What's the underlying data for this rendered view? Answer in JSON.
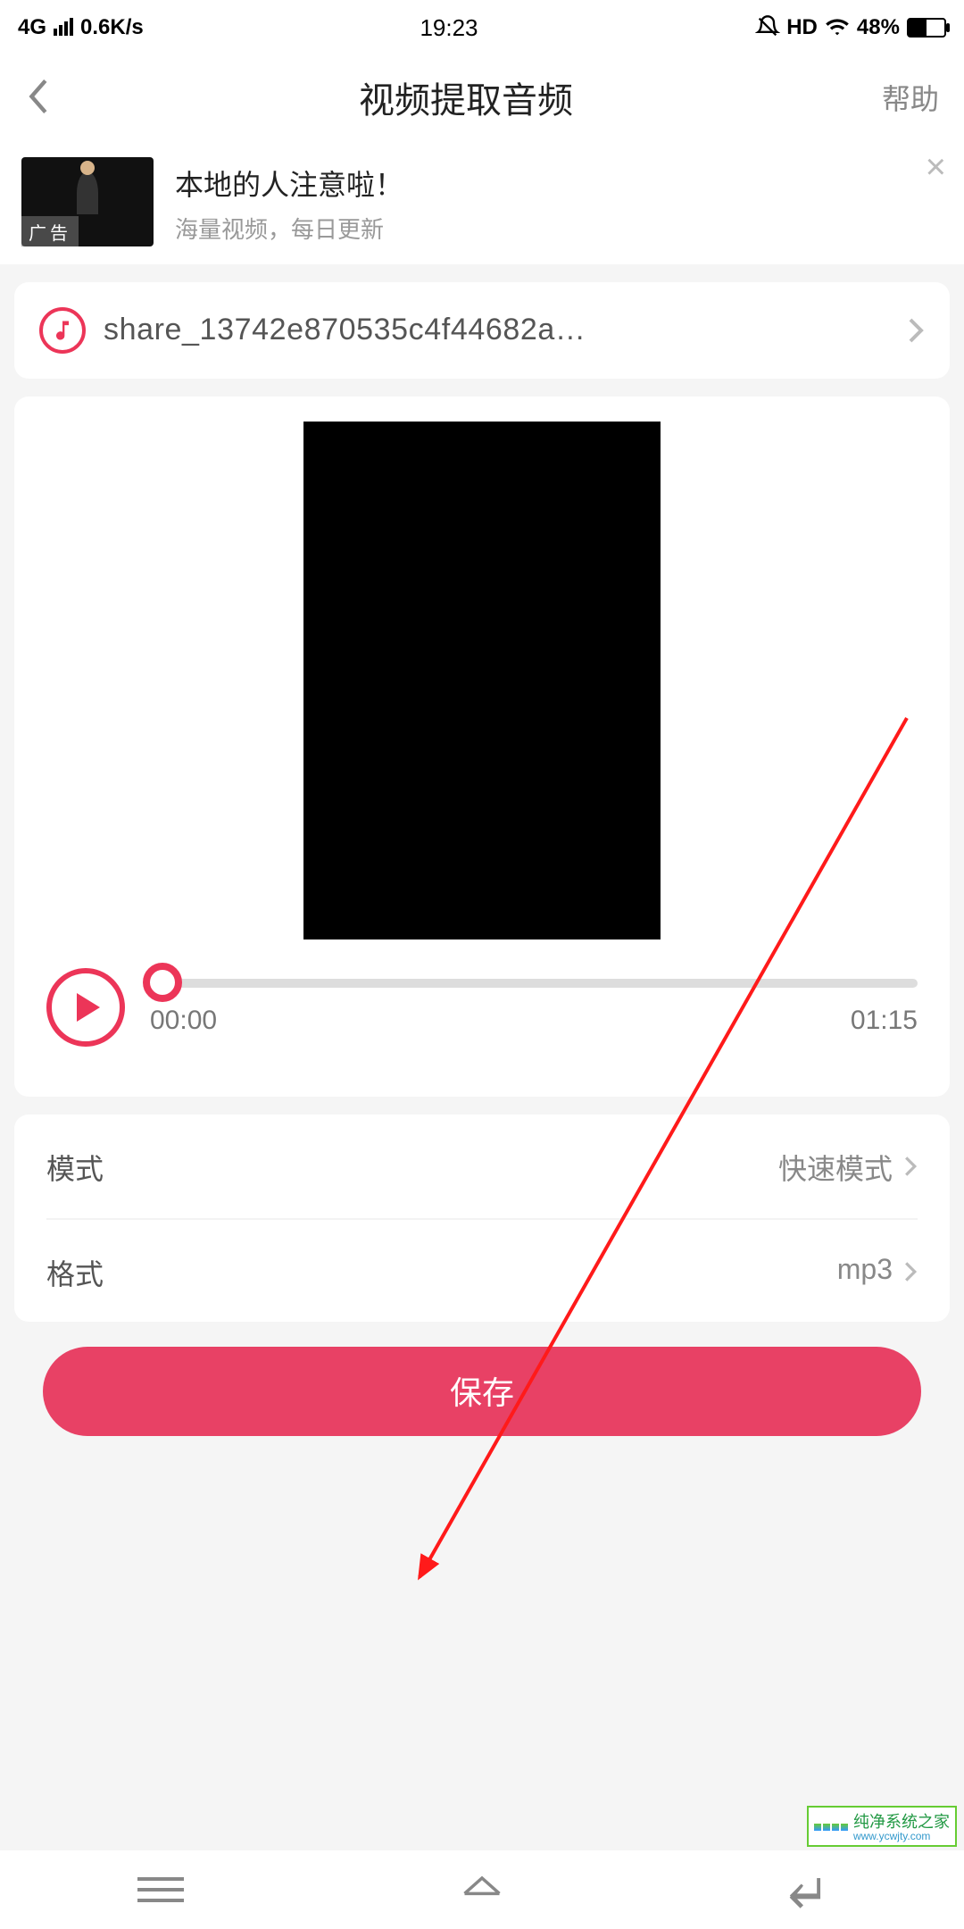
{
  "status": {
    "network": "4G",
    "speed": "0.6K/s",
    "time": "19:23",
    "hd": "HD",
    "battery_pct": "48%"
  },
  "nav": {
    "title": "视频提取音频",
    "help": "帮助"
  },
  "ad": {
    "badge": "广告",
    "title": "本地的人注意啦！",
    "subtitle": "海量视频，每日更新"
  },
  "file": {
    "name": "share_13742e870535c4f44682a…"
  },
  "player": {
    "current": "00:00",
    "total": "01:15"
  },
  "settings": {
    "mode_label": "模式",
    "mode_value": "快速模式",
    "format_label": "格式",
    "format_value": "mp3"
  },
  "save_label": "保存",
  "watermark": {
    "line1": "纯净系统之家",
    "line2": "www.ycwjty.com"
  }
}
